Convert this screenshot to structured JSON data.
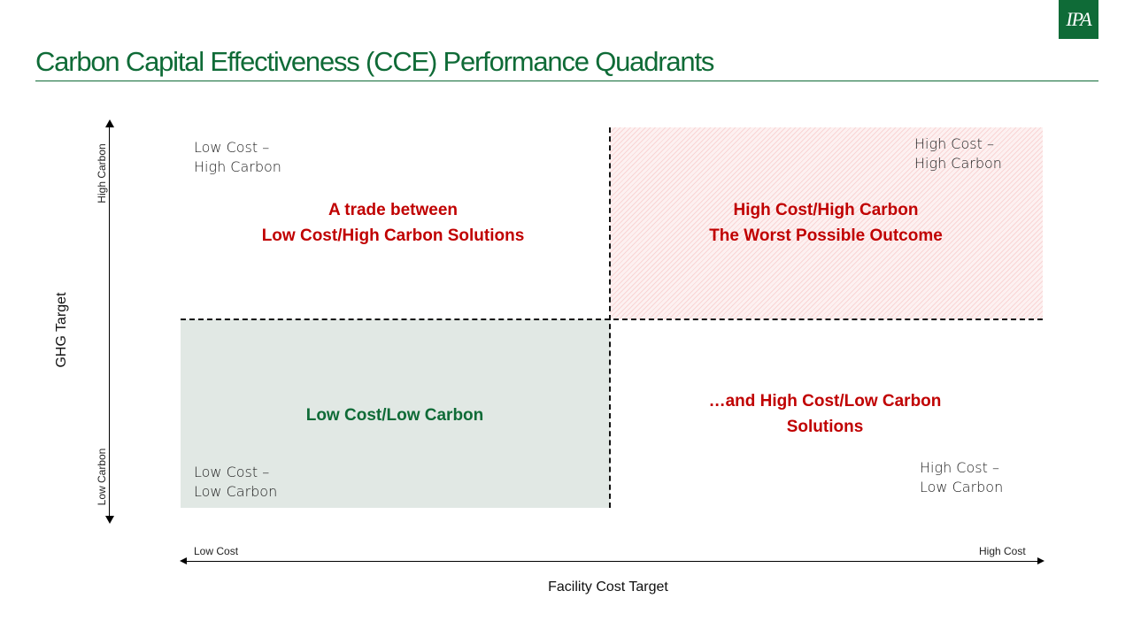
{
  "logo": {
    "text": "IPA",
    "color": "#0f6b37"
  },
  "title": "Carbon Capital Effectiveness (CCE) Performance Quadrants",
  "colors": {
    "brand_green": "#0f6b37",
    "warning_red": "#c00000",
    "low_low_fill": "#e1e8e4",
    "high_high_fill": "#fdf1f1"
  },
  "y_axis": {
    "title": "GHG Target",
    "top_label": "High Carbon",
    "bottom_label": "Low Carbon"
  },
  "x_axis": {
    "title": "Facility Cost Target",
    "left_label": "Low Cost",
    "right_label": "High Cost"
  },
  "quadrants": {
    "top_left": {
      "corner_line1": "Low Cost –",
      "corner_line2": "High Carbon",
      "heading_line1": "A trade between",
      "heading_line2": "Low Cost/High Carbon Solutions"
    },
    "top_right": {
      "corner_line1": "High Cost –",
      "corner_line2": "High Carbon",
      "heading_line1": "High Cost/High Carbon",
      "heading_line2": "The Worst Possible Outcome"
    },
    "bottom_left": {
      "corner_line1": "Low Cost –",
      "corner_line2": "Low Carbon",
      "heading_line1": "Low Cost/Low Carbon"
    },
    "bottom_right": {
      "corner_line1": "High Cost –",
      "corner_line2": "Low Carbon",
      "heading_line1": "…and High Cost/Low Carbon",
      "heading_line2": "Solutions"
    }
  }
}
